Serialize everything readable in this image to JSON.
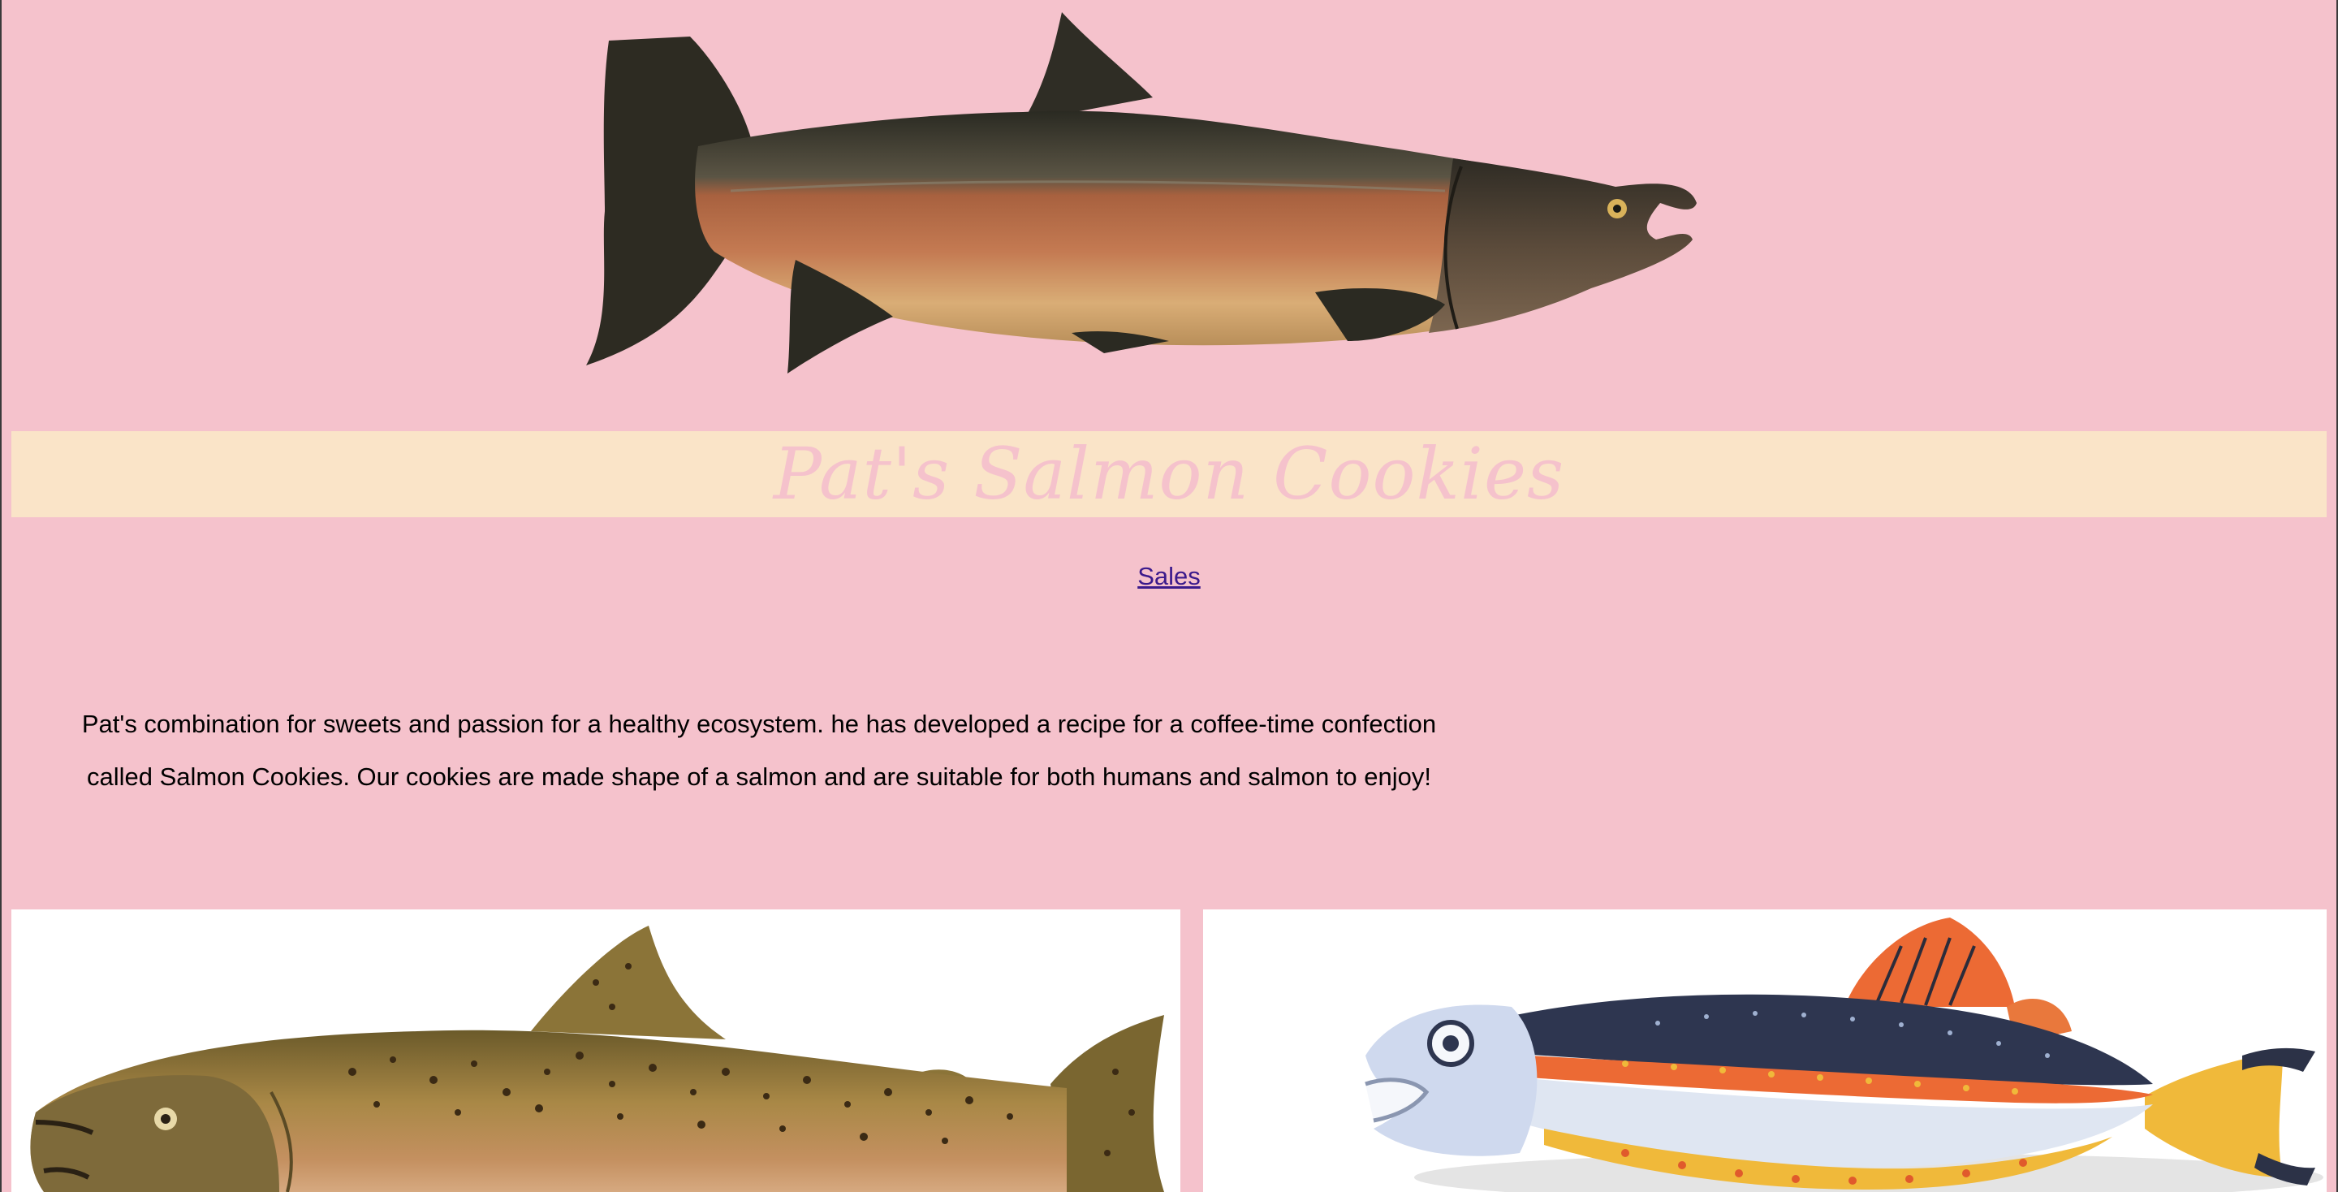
{
  "header": {
    "hero_image": "salmon-illustration",
    "title": "Pat's Salmon Cookies"
  },
  "nav": {
    "links": [
      {
        "label": "Sales"
      }
    ]
  },
  "main": {
    "intro": "Pat's combination for sweets and passion for a healthy ecosystem. he has developed a recipe for a coffee-time confection called Salmon Cookies. Our cookies are made shape of a salmon and are suitable for both humans and salmon to enjoy!"
  },
  "gallery": {
    "images": [
      {
        "name": "trout-illustration"
      },
      {
        "name": "carved-fish-art"
      }
    ]
  },
  "colors": {
    "background": "#f5c2cc",
    "banner": "#fae4c8",
    "title_text": "#f5c2cc",
    "link": "#3b1a8c"
  }
}
